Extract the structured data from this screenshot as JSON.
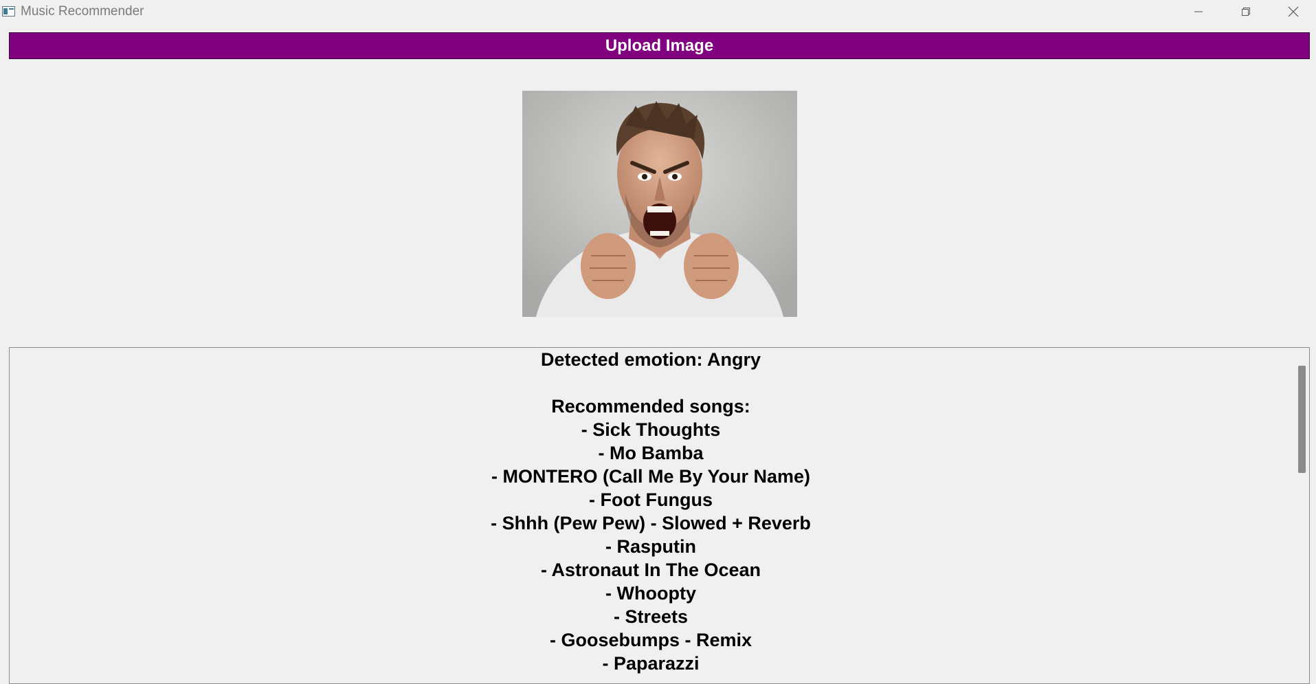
{
  "window": {
    "title": "Music Recommender"
  },
  "upload_button": {
    "label": "Upload Image"
  },
  "image": {
    "description_icon": "uploaded-photo"
  },
  "result": {
    "emotion_line": "Detected emotion: Angry",
    "blank_line": "",
    "songs_heading": "Recommended songs:",
    "songs": [
      "- Sick Thoughts",
      "- Mo Bamba",
      "- MONTERO (Call Me By Your Name)",
      "- Foot Fungus",
      "- Shhh (Pew Pew) - Slowed + Reverb",
      "- Rasputin",
      "- Astronaut In The Ocean",
      "- Whoopty",
      "- Streets",
      "- Goosebumps - Remix",
      "- Paparazzi"
    ]
  },
  "colors": {
    "upload_button_bg": "#800080",
    "window_bg": "#f0f0f0"
  }
}
